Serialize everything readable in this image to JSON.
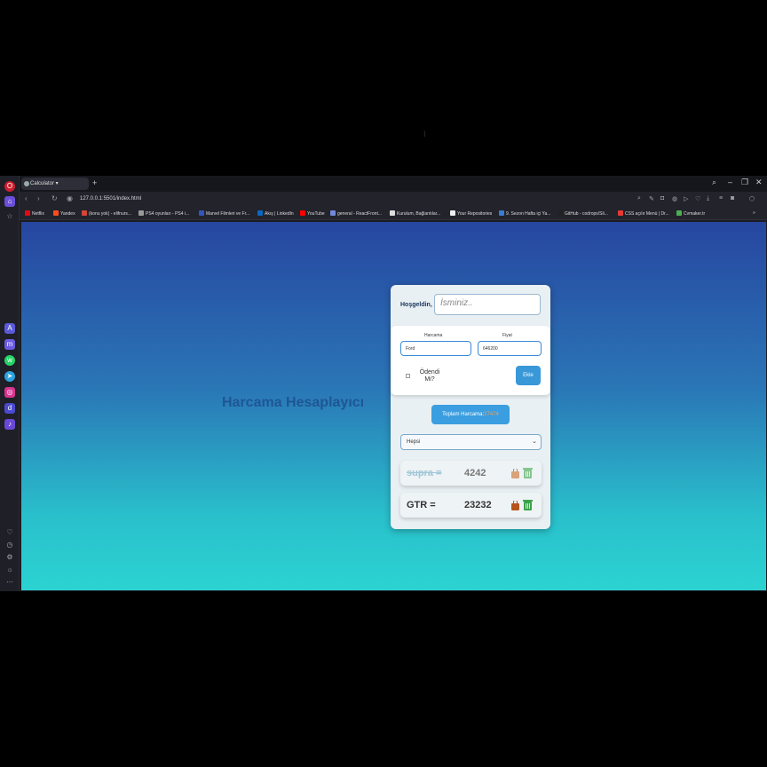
{
  "browser": {
    "tab_title": "Calculator",
    "new_tab": "+",
    "url": "127.0.0.1:5501/index.html",
    "bookmarks": [
      {
        "label": "Netflix",
        "color": "#e50914"
      },
      {
        "label": "Yandex",
        "color": "#ff4c1c"
      },
      {
        "label": "(konu yok) - elifnurs...",
        "color": "#d44638"
      },
      {
        "label": "PS4 oyunları - PS4 i...",
        "color": "#999999"
      },
      {
        "label": "Marvel Filmleri ve Fr...",
        "color": "#3355bb"
      },
      {
        "label": "Akış | LinkedIn",
        "color": "#0a66c2"
      },
      {
        "label": "YouTube",
        "color": "#ff0000"
      },
      {
        "label": "general - ReactFront...",
        "color": "#7289da"
      },
      {
        "label": "Kurulum, Bağlantılar...",
        "color": "#dddddd"
      },
      {
        "label": "Your Repositories",
        "color": "#eeeeee"
      },
      {
        "label": "9. Sezon Hafta içi Ya...",
        "color": "#3a7bd5"
      },
      {
        "label": "GitHub - codrops/Sli...",
        "color": "#222222"
      },
      {
        "label": "CSS açılır Menü | Dr...",
        "color": "#e53935"
      },
      {
        "label": "Cvmaker.tr",
        "color": "#4caf50"
      }
    ]
  },
  "app": {
    "heading": "Harcama Hesaplayıcı",
    "greeting": "Hoşgeldin,",
    "name_placeholder": "İsminiz..",
    "expense_label": "Harcama",
    "expense_value": "Ford",
    "price_label": "Fiyat",
    "price_value": "646200",
    "paid_label": "Ödendi Mi?",
    "add_button": "Ekle",
    "total_label": "Toplam Harcama:",
    "total_value": "27474",
    "filter_selected": "Hepsi",
    "items": [
      {
        "name": "supra =",
        "price": "4242",
        "paid": true
      },
      {
        "name": "GTR =",
        "price": "23232",
        "paid": false
      }
    ]
  },
  "colors": {
    "accent": "#3b9ee0",
    "heading": "#1d4f8f",
    "bag_paid": "#d9a27a",
    "bag_unpaid": "#b5541c",
    "bin_paid": "#86c58f",
    "bin_unpaid": "#3aa24a"
  }
}
